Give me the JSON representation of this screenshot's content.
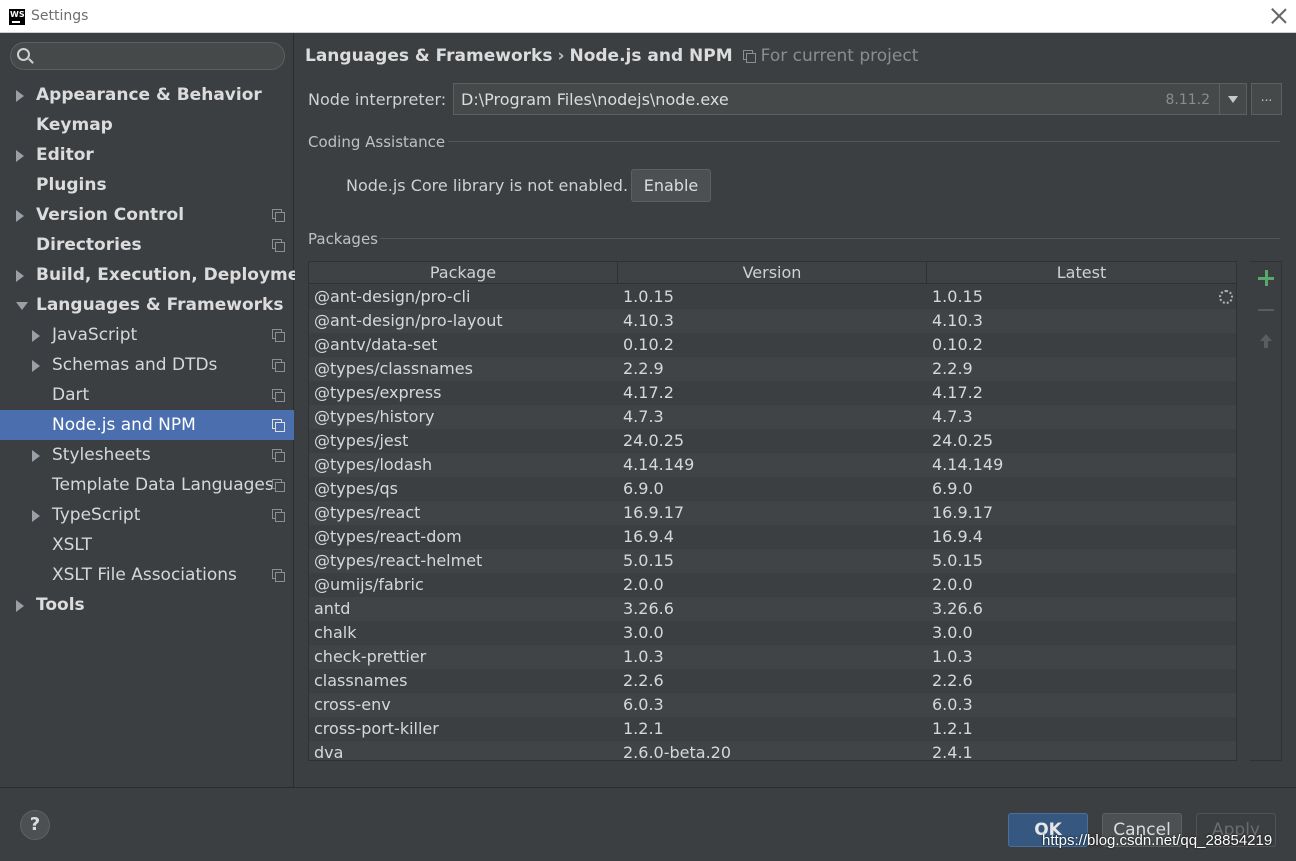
{
  "window": {
    "title": "Settings",
    "app_icon_text": "WS"
  },
  "search": {
    "placeholder": "",
    "value": ""
  },
  "sidebar": {
    "items": [
      {
        "label": "Appearance & Behavior",
        "arrow": "right",
        "bold": true,
        "indent": 0,
        "project": false,
        "selected": false
      },
      {
        "label": "Keymap",
        "arrow": "none",
        "bold": true,
        "indent": 0,
        "project": false,
        "selected": false
      },
      {
        "label": "Editor",
        "arrow": "right",
        "bold": true,
        "indent": 0,
        "project": false,
        "selected": false
      },
      {
        "label": "Plugins",
        "arrow": "none",
        "bold": true,
        "indent": 0,
        "project": false,
        "selected": false
      },
      {
        "label": "Version Control",
        "arrow": "right",
        "bold": true,
        "indent": 0,
        "project": true,
        "selected": false
      },
      {
        "label": "Directories",
        "arrow": "none",
        "bold": true,
        "indent": 0,
        "project": true,
        "selected": false
      },
      {
        "label": "Build, Execution, Deployment",
        "arrow": "right",
        "bold": true,
        "indent": 0,
        "project": false,
        "selected": false
      },
      {
        "label": "Languages & Frameworks",
        "arrow": "down",
        "bold": true,
        "indent": 0,
        "project": false,
        "selected": false
      },
      {
        "label": "JavaScript",
        "arrow": "right",
        "bold": false,
        "indent": 1,
        "project": true,
        "selected": false
      },
      {
        "label": "Schemas and DTDs",
        "arrow": "right",
        "bold": false,
        "indent": 1,
        "project": true,
        "selected": false
      },
      {
        "label": "Dart",
        "arrow": "none",
        "bold": false,
        "indent": 1,
        "project": true,
        "selected": false
      },
      {
        "label": "Node.js and NPM",
        "arrow": "none",
        "bold": false,
        "indent": 1,
        "project": true,
        "selected": true
      },
      {
        "label": "Stylesheets",
        "arrow": "right",
        "bold": false,
        "indent": 1,
        "project": true,
        "selected": false
      },
      {
        "label": "Template Data Languages",
        "arrow": "none",
        "bold": false,
        "indent": 1,
        "project": true,
        "selected": false
      },
      {
        "label": "TypeScript",
        "arrow": "right",
        "bold": false,
        "indent": 1,
        "project": true,
        "selected": false
      },
      {
        "label": "XSLT",
        "arrow": "none",
        "bold": false,
        "indent": 1,
        "project": false,
        "selected": false
      },
      {
        "label": "XSLT File Associations",
        "arrow": "none",
        "bold": false,
        "indent": 1,
        "project": true,
        "selected": false
      },
      {
        "label": "Tools",
        "arrow": "right",
        "bold": true,
        "indent": 0,
        "project": false,
        "selected": false
      }
    ]
  },
  "breadcrumb": {
    "parent": "Languages & Frameworks",
    "separator": "›",
    "current": "Node.js and NPM",
    "scope": "For current project"
  },
  "interpreter": {
    "label": "Node interpreter:",
    "value": "D:\\Program Files\\nodejs\\node.exe",
    "version": "8.11.2",
    "more_label": "..."
  },
  "coding_assistance": {
    "title": "Coding Assistance",
    "message": "Node.js Core library is not enabled.",
    "enable_label": "Enable"
  },
  "packages": {
    "title": "Packages",
    "columns": [
      "Package",
      "Version",
      "Latest"
    ],
    "rows": [
      [
        "@ant-design/pro-cli",
        "1.0.15",
        "1.0.15"
      ],
      [
        "@ant-design/pro-layout",
        "4.10.3",
        "4.10.3"
      ],
      [
        "@antv/data-set",
        "0.10.2",
        "0.10.2"
      ],
      [
        "@types/classnames",
        "2.2.9",
        "2.2.9"
      ],
      [
        "@types/express",
        "4.17.2",
        "4.17.2"
      ],
      [
        "@types/history",
        "4.7.3",
        "4.7.3"
      ],
      [
        "@types/jest",
        "24.0.25",
        "24.0.25"
      ],
      [
        "@types/lodash",
        "4.14.149",
        "4.14.149"
      ],
      [
        "@types/qs",
        "6.9.0",
        "6.9.0"
      ],
      [
        "@types/react",
        "16.9.17",
        "16.9.17"
      ],
      [
        "@types/react-dom",
        "16.9.4",
        "16.9.4"
      ],
      [
        "@types/react-helmet",
        "5.0.15",
        "5.0.15"
      ],
      [
        "@umijs/fabric",
        "2.0.0",
        "2.0.0"
      ],
      [
        "antd",
        "3.26.6",
        "3.26.6"
      ],
      [
        "chalk",
        "3.0.0",
        "3.0.0"
      ],
      [
        "check-prettier",
        "1.0.3",
        "1.0.3"
      ],
      [
        "classnames",
        "2.2.6",
        "2.2.6"
      ],
      [
        "cross-env",
        "6.0.3",
        "6.0.3"
      ],
      [
        "cross-port-killer",
        "1.2.1",
        "1.2.1"
      ],
      [
        "dva",
        "2.6.0-beta.20",
        "2.4.1"
      ]
    ]
  },
  "footer": {
    "help_label": "?",
    "ok_label": "OK",
    "cancel_label": "Cancel",
    "apply_label": "Apply"
  },
  "watermark": "https://blog.csdn.net/qq_28854219",
  "colors": {
    "background": "#3c3f41",
    "selection": "#4b6eaf",
    "ok_button": "#365880",
    "add_icon": "#59a869"
  }
}
